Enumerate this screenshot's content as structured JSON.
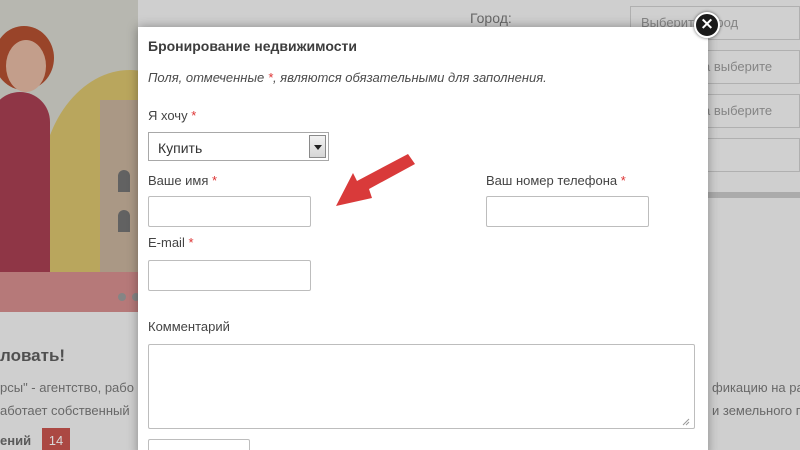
{
  "background": {
    "city_label": "Город:",
    "selects": [
      "Выберите город",
      "а выберите",
      "а выберите",
      ""
    ],
    "heading": "ловать!",
    "text_line1_left": "рсы\" - агентство, рабо",
    "text_line1_right": "фикацию на ра",
    "text_line2_left": "аботает собственный",
    "text_line2_right": "и земельного п",
    "text_line3_left": "ений",
    "badge": "14"
  },
  "modal": {
    "title": "Бронирование недвижимости",
    "note_before": "Поля, отмеченные ",
    "note_star": "*",
    "note_after": ", являются обязательными для заполнения.",
    "want_label": "Я хочу",
    "want_value": "Купить",
    "name_label": "Ваше имя",
    "phone_label": "Ваш номер телефона",
    "email_label": "E-mail",
    "comment_label": "Комментарий",
    "required_mark": "*",
    "close_symbol": "×"
  },
  "colors": {
    "required": "#d33333",
    "arrow": "#d93a3a"
  }
}
